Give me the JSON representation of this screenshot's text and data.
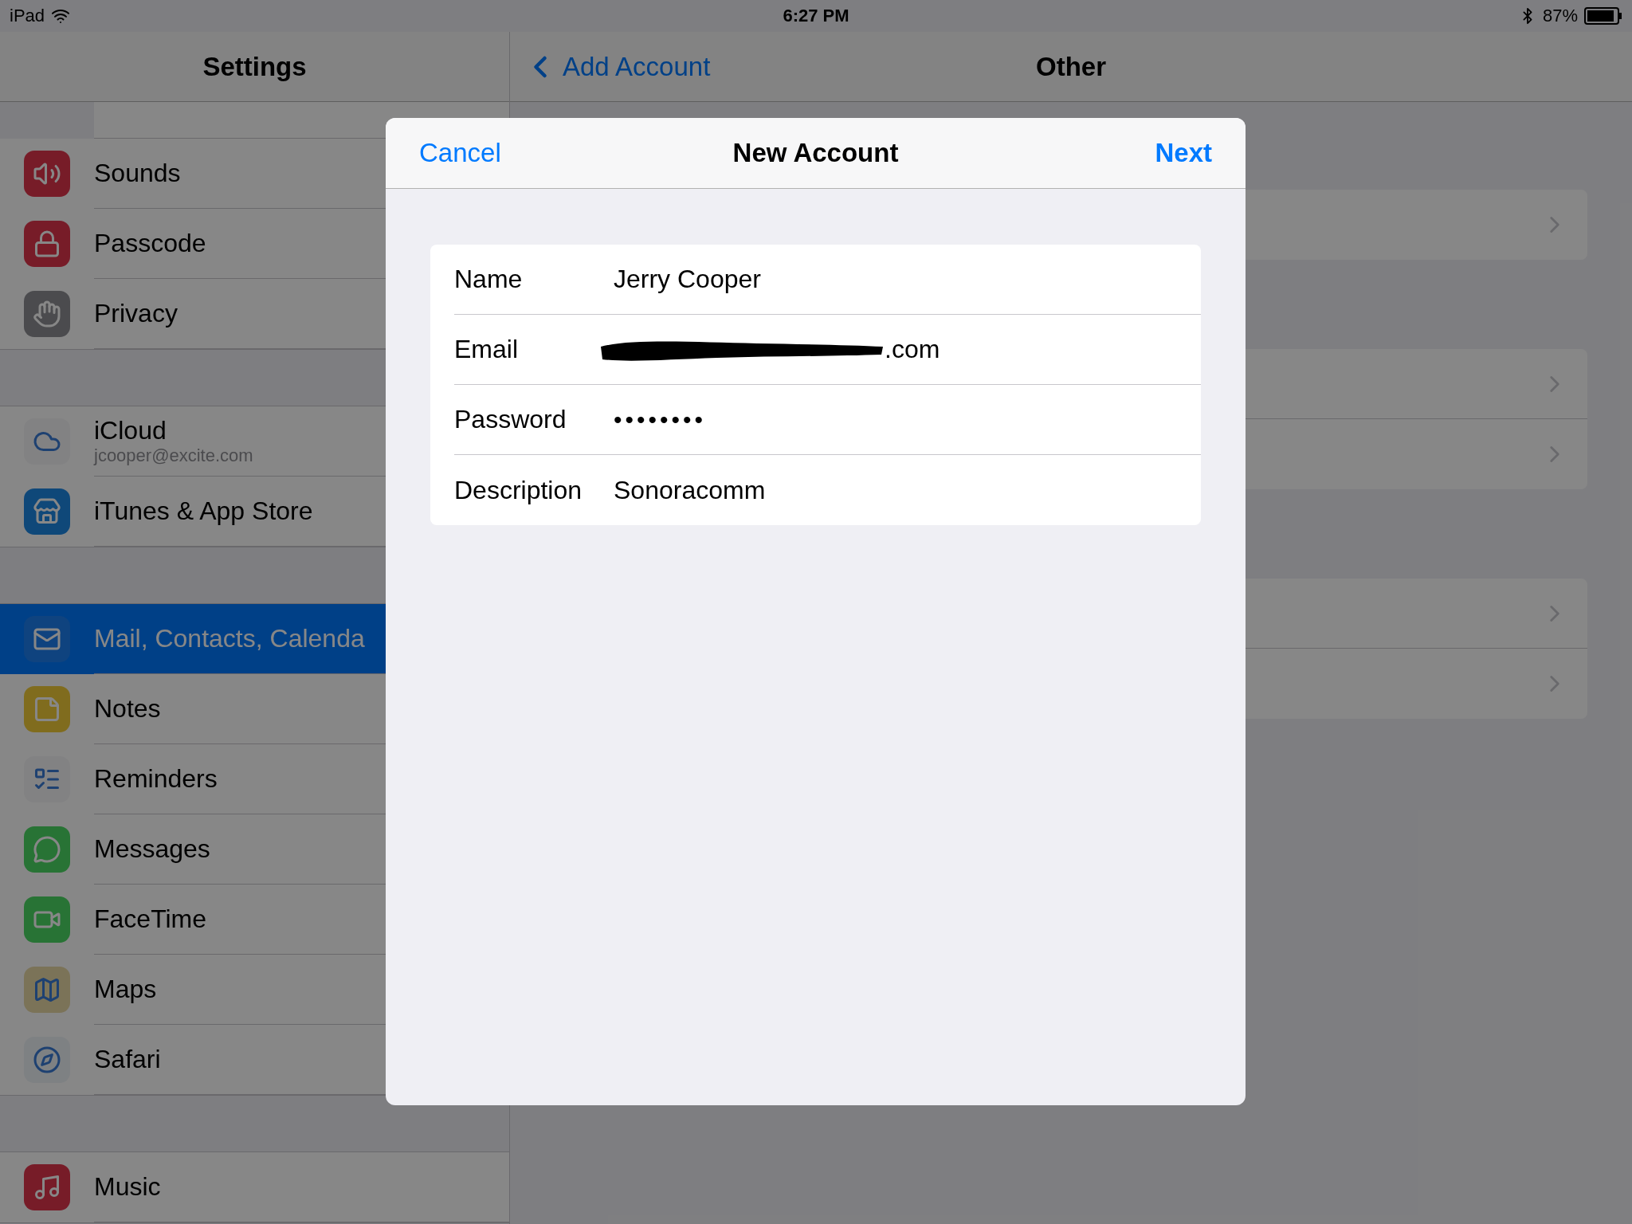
{
  "status_bar": {
    "device": "iPad",
    "time": "6:27 PM",
    "battery": "87%"
  },
  "sidebar": {
    "title": "Settings",
    "groups": [
      [
        {
          "label": "Sounds",
          "selected": false
        },
        {
          "label": "Passcode",
          "selected": false
        },
        {
          "label": "Privacy",
          "selected": false
        }
      ],
      [
        {
          "label": "iCloud",
          "subtitle": "jcooper@excite.com",
          "selected": false
        },
        {
          "label": "iTunes & App Store",
          "selected": false
        }
      ],
      [
        {
          "label": "Mail, Contacts, Calenda",
          "selected": true
        },
        {
          "label": "Notes",
          "selected": false
        },
        {
          "label": "Reminders",
          "selected": false
        },
        {
          "label": "Messages",
          "selected": false
        },
        {
          "label": "FaceTime",
          "selected": false
        },
        {
          "label": "Maps",
          "selected": false
        },
        {
          "label": "Safari",
          "selected": false
        }
      ],
      [
        {
          "label": "Music",
          "selected": false
        }
      ]
    ]
  },
  "detail": {
    "back": "Add Account",
    "title": "Other",
    "groups": [
      {
        "rows": [
          {
            "kind": "link"
          }
        ]
      },
      {
        "rows": [
          {
            "kind": "link"
          },
          {
            "kind": "link"
          }
        ]
      },
      {
        "rows": [
          {
            "kind": "link"
          },
          {
            "kind": "link"
          }
        ]
      }
    ]
  },
  "modal": {
    "cancel": "Cancel",
    "title": "New Account",
    "next": "Next",
    "fields": [
      {
        "label": "Name",
        "value": "Jerry Cooper",
        "kind": "text"
      },
      {
        "label": "Email",
        "value": ".com",
        "kind": "redacted"
      },
      {
        "label": "Password",
        "value": "••••••••",
        "kind": "text"
      },
      {
        "label": "Description",
        "value": "Sonoracomm",
        "kind": "text"
      }
    ]
  }
}
